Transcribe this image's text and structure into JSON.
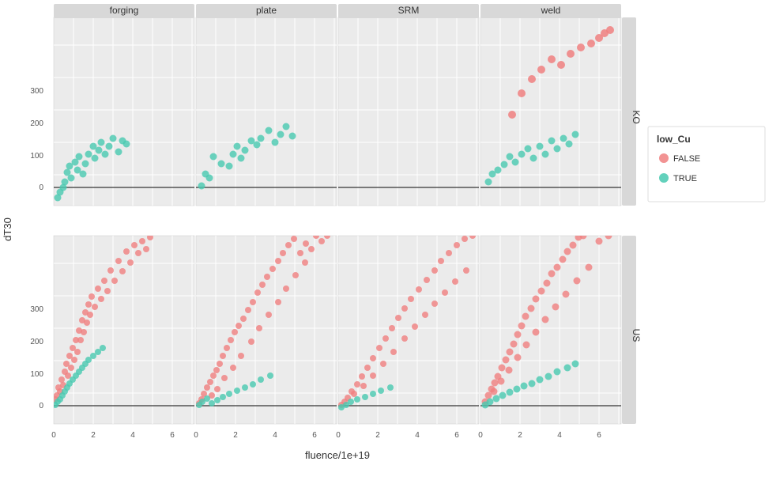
{
  "chart": {
    "title": "",
    "xLabel": "fluence/1e+19",
    "yLabel": "dT30",
    "columns": [
      "forging",
      "plate",
      "SRM",
      "weld"
    ],
    "rows": [
      "KO",
      "US"
    ],
    "legend": {
      "title": "low_Cu",
      "items": [
        {
          "label": "FALSE",
          "color": "#F08080"
        },
        {
          "label": "TRUE",
          "color": "#48C9B0"
        }
      ]
    },
    "xAxisTicks": [
      "0",
      "2",
      "4",
      "6"
    ],
    "yAxisTicks": [
      "0",
      "100",
      "200",
      "300"
    ]
  }
}
